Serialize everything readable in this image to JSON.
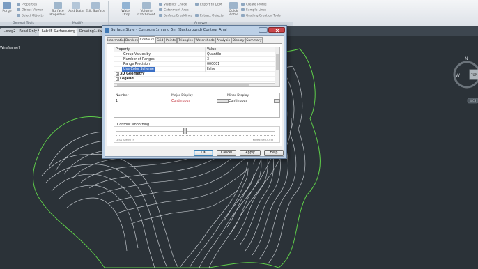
{
  "ribbon": {
    "groups": [
      {
        "label": "General Tools"
      },
      {
        "label": "Modify"
      },
      {
        "label": "Analyze"
      }
    ],
    "buttons": {
      "purge": "Purge",
      "properties": "Properties",
      "object_viewer": "Object Viewer",
      "select_objects": "Select Objects",
      "surface_properties": "Surface Properties",
      "add_data": "Add Data",
      "edit_surface": "Edit Surface",
      "water_drop": "Water Drop",
      "volume_catchment": "Volume Catchment",
      "visibility_check": "Visibility Check",
      "catchment_area": "Catchment Area",
      "surface_breaklines": "Surface Breaklines",
      "export_dem": "Export to DEM",
      "extract_objects": "Extract Objects",
      "quick_profile": "Quick Profile",
      "create_profile": "Create Profile",
      "sample_lines": "Sample Lines",
      "grading_creation": "Grading Creation Tools"
    }
  },
  "tabs": [
    {
      "label": "...dwg2 - Read Only *"
    },
    {
      "label": "Lab45 Surface.dwg *"
    },
    {
      "label": "Drawing1.dwg"
    }
  ],
  "viewport": {
    "label": "Wireframe]"
  },
  "viewcube": {
    "north": "N",
    "west": "W",
    "top": "TOP",
    "wcs": "WCS"
  },
  "dialog": {
    "title": "Surface Style - Contours 1m and 5m (Background) Contour Anal",
    "tabs": [
      "Information",
      "Borders",
      "Contours",
      "Grid",
      "Points",
      "Triangles",
      "Watersheds",
      "Analysis",
      "Display",
      "Summary"
    ],
    "active_tab": "Contours",
    "properties": {
      "header_property": "Property",
      "header_value": "Value",
      "rows": [
        {
          "name": "Group Values by",
          "value": "Quantile"
        },
        {
          "name": "Number of Ranges",
          "value": "3"
        },
        {
          "name": "Range Precision",
          "value": "000001"
        },
        {
          "name": "Use Color Scheme",
          "value": "False"
        }
      ],
      "categories": [
        {
          "name": "3D Geometry"
        },
        {
          "name": "Legend"
        }
      ]
    },
    "display_table": {
      "col_number": "Number",
      "col_major": "Major Display",
      "col_minor": "Minor Display",
      "row_number": "1",
      "major_value": "Continuous",
      "minor_value": "Continuous"
    },
    "smoothing": {
      "label": "Contour smoothing",
      "min": "LESS SMOOTH",
      "max": "MORE SMOOTH",
      "level_fraction": 0.44
    },
    "buttons": {
      "ok": "OK",
      "cancel": "Cancel",
      "apply": "Apply",
      "help": "Help"
    }
  },
  "colors": {
    "canvas": "#2b3238",
    "contour": "#d8dde2",
    "boundary": "#5fcf4a",
    "selection": "#3a6fc6"
  }
}
